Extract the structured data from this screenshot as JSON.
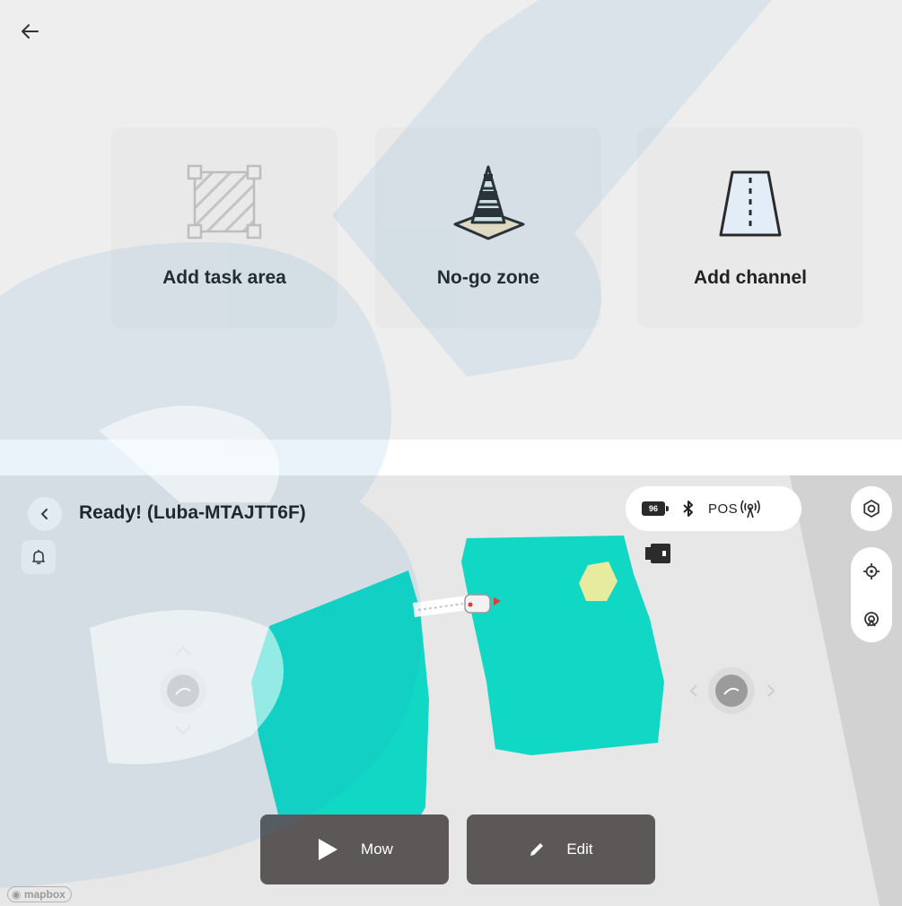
{
  "top_panel": {
    "cards": [
      {
        "label": "Add task area",
        "icon": "task-area-icon"
      },
      {
        "label": "No-go zone",
        "icon": "traffic-cone-icon"
      },
      {
        "label": "Add channel",
        "icon": "channel-road-icon"
      }
    ]
  },
  "map_view": {
    "status_title": "Ready! (Luba-MTAJTT6F)",
    "status_bar": {
      "battery_level": "96",
      "pos_label": "POS"
    },
    "actions": {
      "mow_label": "Mow",
      "edit_label": "Edit"
    },
    "attribution": "mapbox"
  },
  "colors": {
    "zone_fill": "#10d8c4",
    "no_go_fill": "#e6eb9d",
    "action_button": "#5b5857"
  }
}
